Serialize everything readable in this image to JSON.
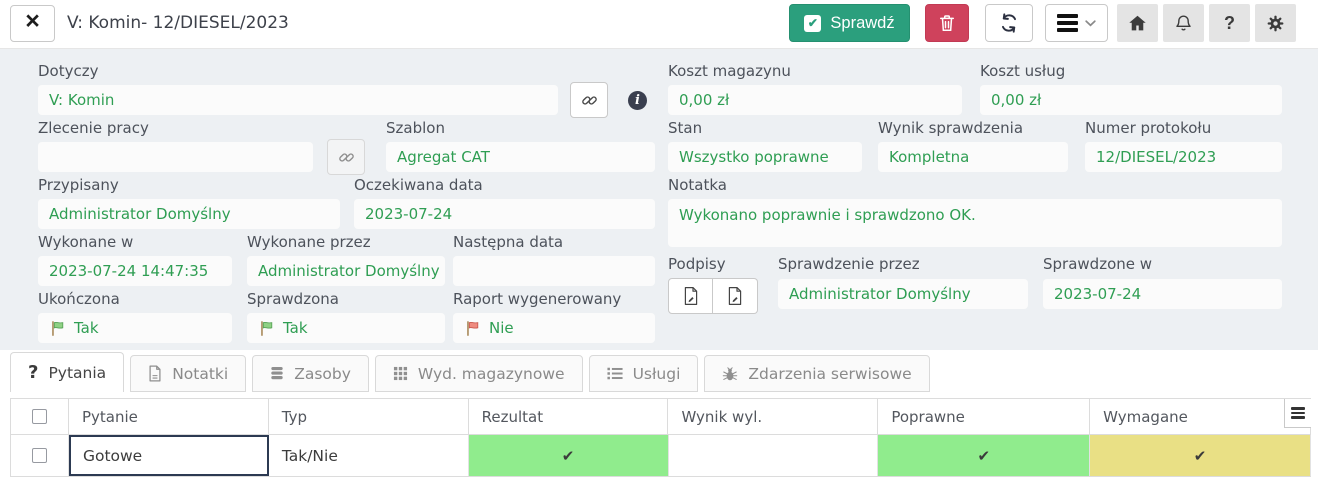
{
  "glyphs": {
    "check": "✔",
    "close": "×",
    "question": "?"
  },
  "colors": {
    "accent_green": "#2b9f7d",
    "danger_red": "#cf425c",
    "value_green": "#2f9e53",
    "cell_green": "#90ec8d",
    "cell_yellow": "#e9e085",
    "form_bg": "#edf0f3"
  },
  "header": {
    "title": "V: Komin- 12/DIESEL/2023",
    "check_button_label": "Sprawdź"
  },
  "form": {
    "dotyczy": {
      "label": "Dotyczy",
      "value": "V: Komin"
    },
    "zlecenie_pracy": {
      "label": "Zlecenie pracy",
      "value": ""
    },
    "szablon": {
      "label": "Szablon",
      "value": "Agregat CAT"
    },
    "przypisany": {
      "label": "Przypisany",
      "value": "Administrator Domyślny"
    },
    "oczekiwana_data": {
      "label": "Oczekiwana data",
      "value": "2023-07-24"
    },
    "wykonane_w": {
      "label": "Wykonane w",
      "value": "2023-07-24 14:47:35"
    },
    "wykonane_przez": {
      "label": "Wykonane przez",
      "value": "Administrator Domyślny"
    },
    "nastepna_data": {
      "label": "Następna data",
      "value": ""
    },
    "ukonczona": {
      "label": "Ukończona",
      "value": "Tak"
    },
    "sprawdzona": {
      "label": "Sprawdzona",
      "value": "Tak"
    },
    "raport_wygenerowany": {
      "label": "Raport wygenerowany",
      "value": "Nie"
    },
    "koszt_magazynu": {
      "label": "Koszt magazynu",
      "value": "0,00 zł"
    },
    "koszt_uslug": {
      "label": "Koszt usług",
      "value": "0,00 zł"
    },
    "stan": {
      "label": "Stan",
      "value": "Wszystko poprawne"
    },
    "wynik_sprawdzenia": {
      "label": "Wynik sprawdzenia",
      "value": "Kompletna"
    },
    "numer_protokolu": {
      "label": "Numer protokołu",
      "value": "12/DIESEL/2023"
    },
    "notatka": {
      "label": "Notatka",
      "value": "Wykonano poprawnie i sprawdzono OK."
    },
    "podpisy": {
      "label": "Podpisy"
    },
    "sprawdzenie_przez": {
      "label": "Sprawdzenie przez",
      "value": "Administrator Domyślny"
    },
    "sprawdzone_w": {
      "label": "Sprawdzone w",
      "value": "2023-07-24"
    }
  },
  "tabs": [
    {
      "label": "Pytania"
    },
    {
      "label": "Notatki"
    },
    {
      "label": "Zasoby"
    },
    {
      "label": "Wyd. magazynowe"
    },
    {
      "label": "Usługi"
    },
    {
      "label": "Zdarzenia serwisowe"
    }
  ],
  "table": {
    "columns": [
      "Pytanie",
      "Typ",
      "Rezultat",
      "Wynik wyl.",
      "Poprawne",
      "Wymagane"
    ],
    "rows": [
      {
        "pytanie": "Gotowe",
        "typ": "Tak/Nie",
        "rezultat": "✔",
        "wynik_wyl": "",
        "poprawne": "✔",
        "wymagane": "✔"
      }
    ]
  }
}
